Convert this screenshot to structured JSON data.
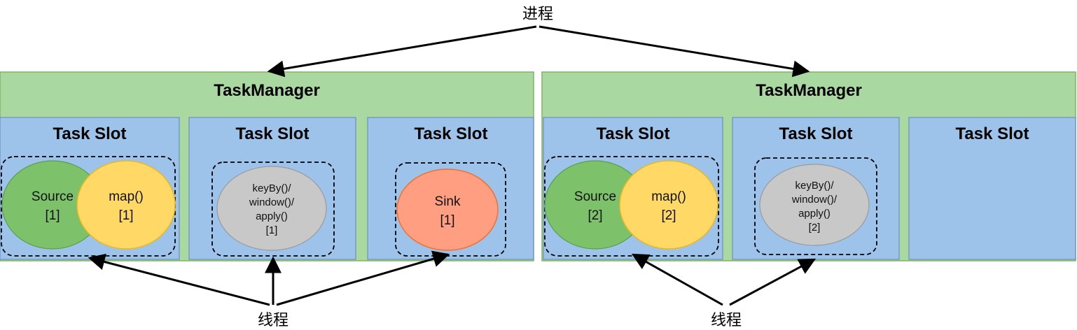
{
  "process_label": "进程",
  "thread_label_left": "线程",
  "thread_label_right": "线程",
  "colors": {
    "taskmanager_fill": "#a9d8a0",
    "taskmanager_stroke": "#82b366",
    "slot_fill": "#9ec3ea",
    "slot_stroke": "#6c8ebf",
    "source_fill": "#7dc26a",
    "map_fill": "#ffd866",
    "keyby_fill": "#c8c8c8",
    "sink_fill": "#ff9e80"
  },
  "taskmanagers": [
    {
      "title": "TaskManager",
      "slots": [
        {
          "title": "Task Slot",
          "ops": [
            {
              "kind": "source",
              "lines": [
                "Source",
                "[1]"
              ]
            },
            {
              "kind": "map",
              "lines": [
                "map()",
                "[1]"
              ]
            }
          ]
        },
        {
          "title": "Task Slot",
          "ops": [
            {
              "kind": "keyby",
              "lines": [
                "keyBy()/",
                "window()/",
                "apply()",
                "[1]"
              ]
            }
          ]
        },
        {
          "title": "Task Slot",
          "ops": [
            {
              "kind": "sink",
              "lines": [
                "Sink",
                "[1]"
              ]
            }
          ]
        }
      ]
    },
    {
      "title": "TaskManager",
      "slots": [
        {
          "title": "Task Slot",
          "ops": [
            {
              "kind": "source",
              "lines": [
                "Source",
                "[2]"
              ]
            },
            {
              "kind": "map",
              "lines": [
                "map()",
                "[2]"
              ]
            }
          ]
        },
        {
          "title": "Task Slot",
          "ops": [
            {
              "kind": "keyby",
              "lines": [
                "keyBy()/",
                "window()/",
                "apply()",
                "[2]"
              ]
            }
          ]
        },
        {
          "title": "Task Slot",
          "ops": []
        }
      ]
    }
  ]
}
